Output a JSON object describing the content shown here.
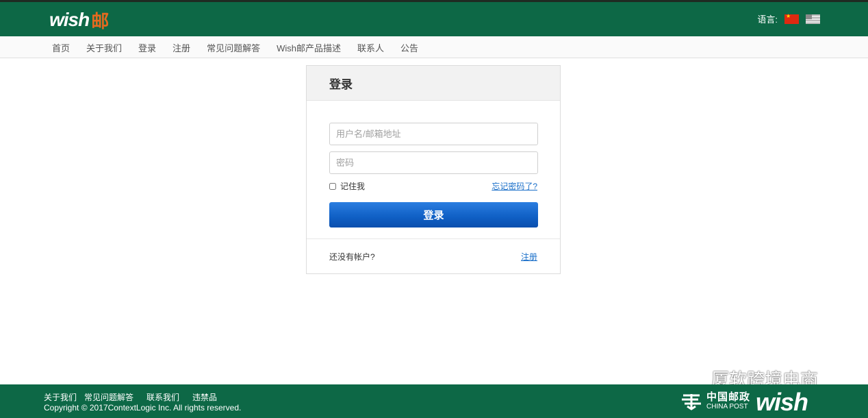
{
  "header": {
    "logo_wish": "wish",
    "logo_you": "邮",
    "language_label": "语言:",
    "colors": {
      "header_bg": "#0d6846",
      "logo_accent": "#e46a1f"
    }
  },
  "nav": {
    "items": [
      {
        "label": "首页"
      },
      {
        "label": "关于我们"
      },
      {
        "label": "登录"
      },
      {
        "label": "注册"
      },
      {
        "label": "常见问题解答"
      },
      {
        "label": "Wish邮产品描述"
      },
      {
        "label": "联系人"
      },
      {
        "label": "公告"
      }
    ]
  },
  "login": {
    "title": "登录",
    "username_placeholder": "用户名/邮箱地址",
    "password_placeholder": "密码",
    "remember_label": "记住我",
    "forgot_label": "忘记密码了?",
    "submit_label": "登录",
    "no_account_label": "还没有帐户?",
    "register_label": "注册",
    "colors": {
      "button": "#0f5fc4",
      "link": "#1a6fc9"
    }
  },
  "watermark": {
    "text": "厦软跨境电商",
    "icon": "wechat-icon"
  },
  "footer": {
    "links": [
      {
        "label": "关于我们"
      },
      {
        "label": "常见问题解答"
      },
      {
        "label": "联系我们"
      },
      {
        "label": "违禁品"
      }
    ],
    "copyright": "Copyright © 2017ContextLogic Inc. All rights reserved.",
    "post_cn": "中国邮政",
    "post_en": "CHINA POST",
    "wish_logo": "wish"
  }
}
